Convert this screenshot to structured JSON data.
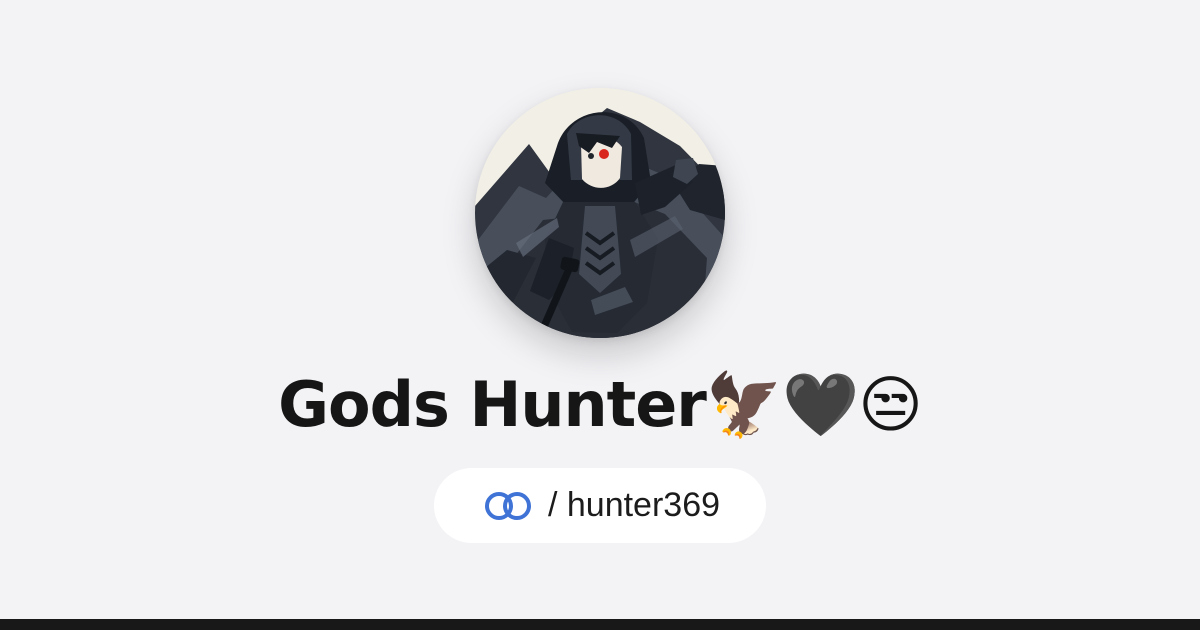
{
  "profile": {
    "display_name": "Gods Hunter🦅🖤😒",
    "handle": "/ hunter369",
    "avatar_icon": "hooded-anime-character-avatar",
    "logo_icon": "linked-rings-logo-icon"
  },
  "colors": {
    "background": "#f3f3f6",
    "logo_blue": "#3f73d6",
    "bottom_bar": "#181818"
  }
}
